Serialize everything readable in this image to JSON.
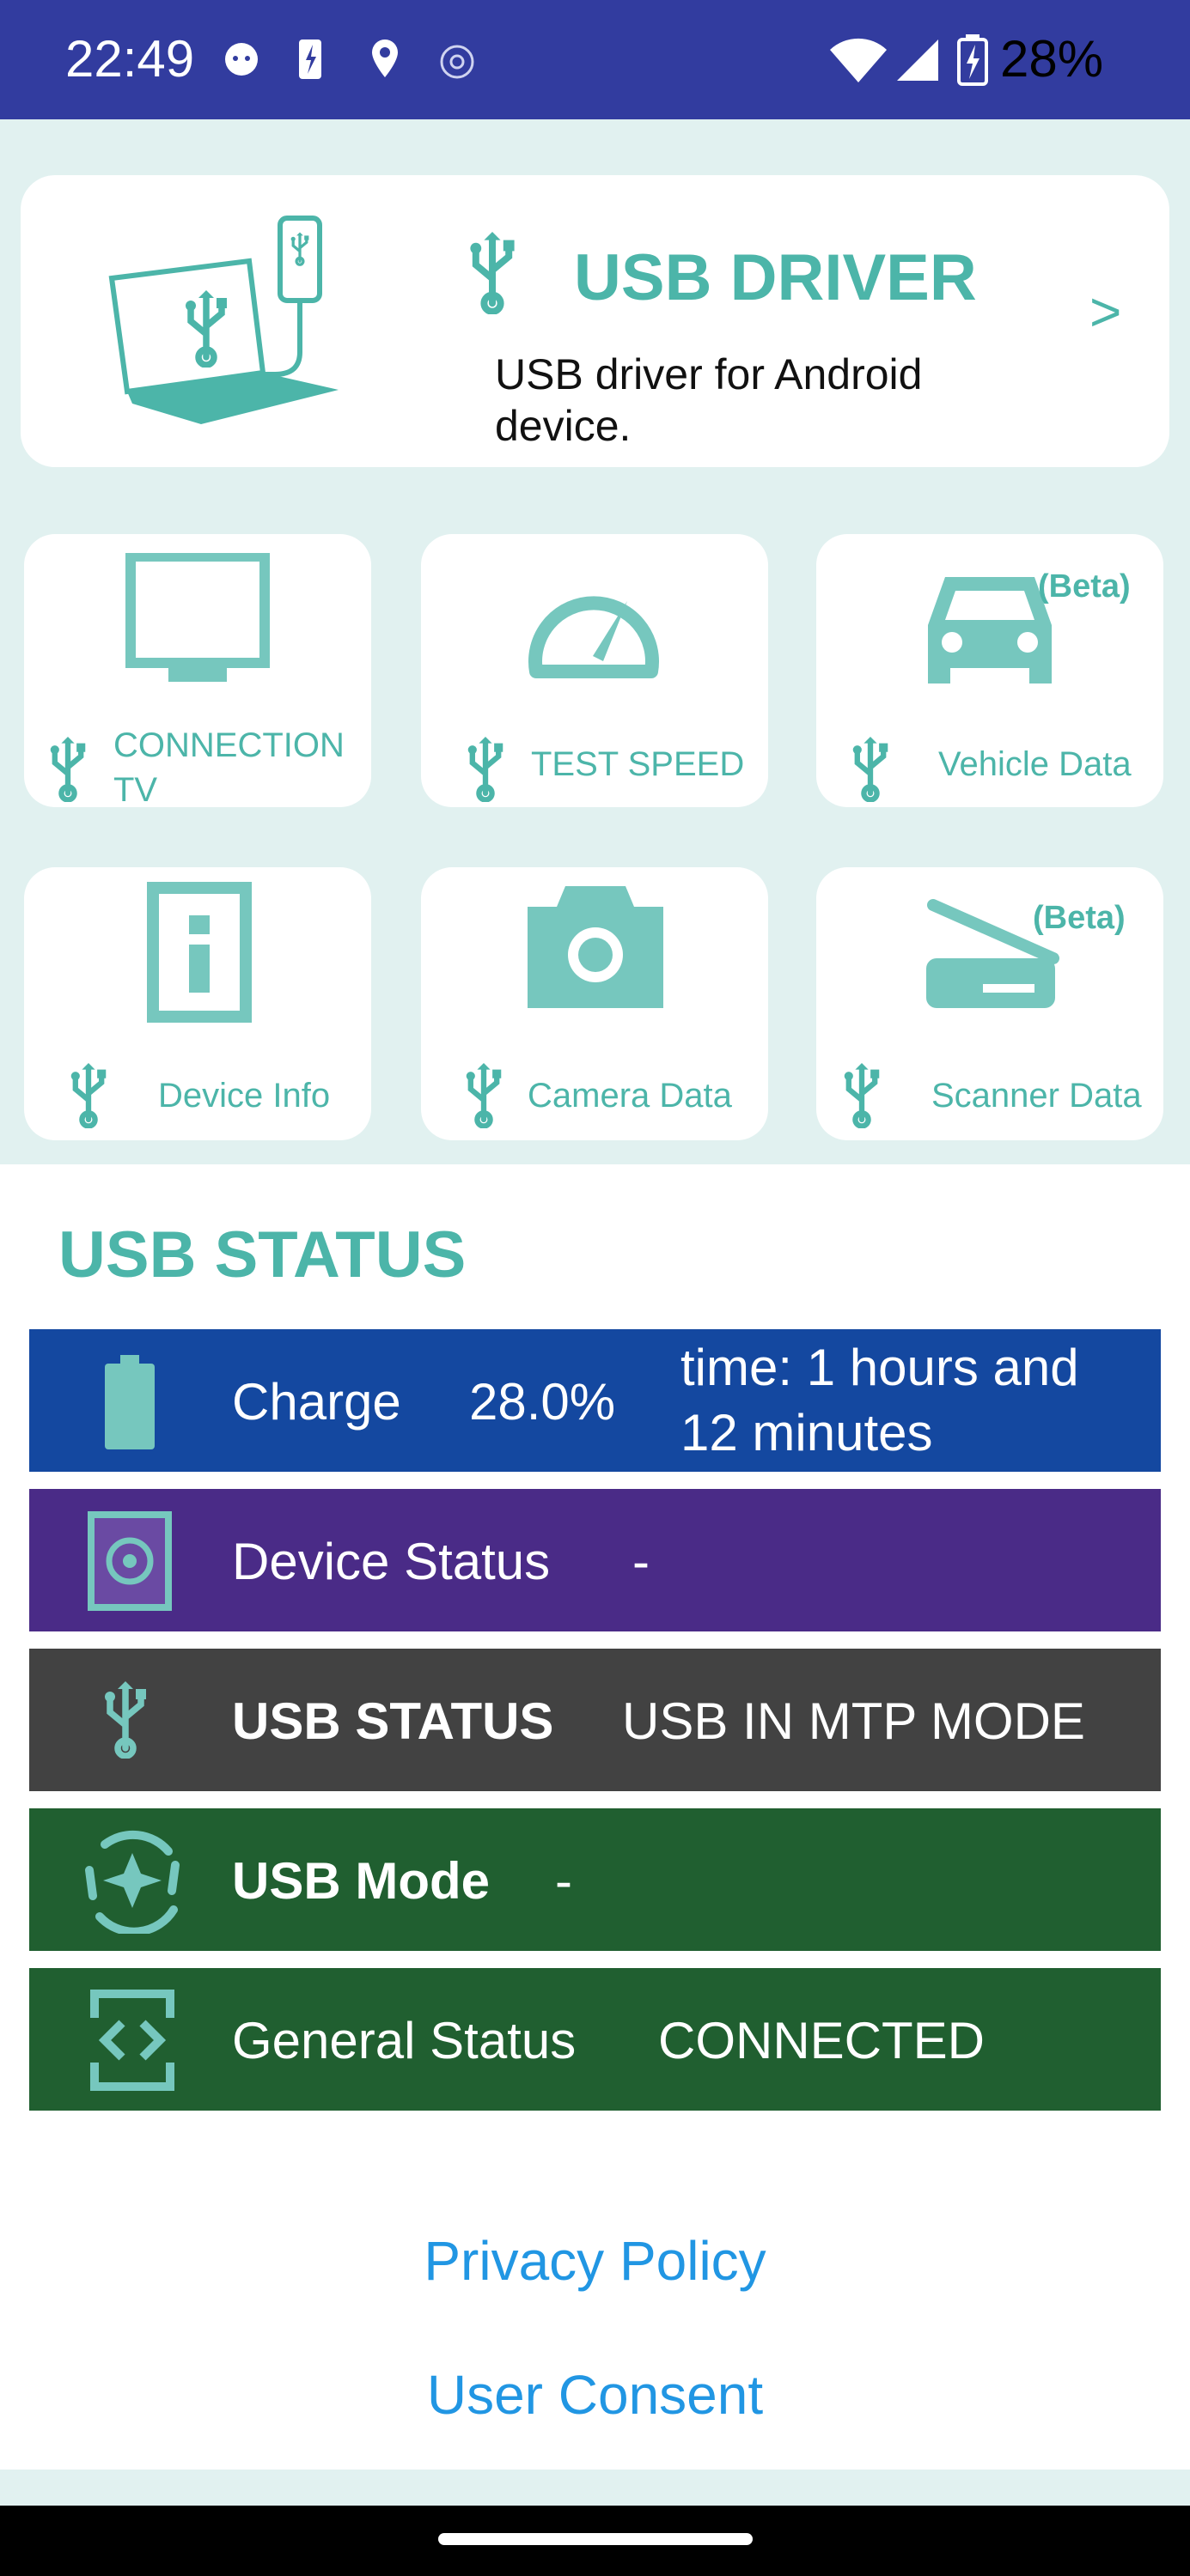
{
  "status_bar": {
    "time": "22:49",
    "battery_percent": "28%"
  },
  "driver_card": {
    "title": "USB DRIVER",
    "description": "USB driver for Android device.",
    "arrow": ">"
  },
  "tiles": [
    {
      "label_line1": "CONNECTION",
      "label_line2": "TV",
      "icon": "tv-icon"
    },
    {
      "label": "TEST SPEED",
      "icon": "speedometer-icon"
    },
    {
      "label": "Vehicle Data",
      "badge": "(Beta)",
      "icon": "car-icon"
    },
    {
      "label": "Device Info",
      "icon": "info-icon"
    },
    {
      "label": "Camera Data",
      "icon": "camera-icon"
    },
    {
      "label": "Scanner Data",
      "badge": "(Beta)",
      "icon": "scanner-icon"
    }
  ],
  "usb_status": {
    "heading": "USB STATUS",
    "rows": [
      {
        "label": "Charge",
        "value": "28.0%",
        "extra_line1": "time: 1 hours and",
        "extra_line2": "12 minutes",
        "color": "#1448a0",
        "icon": "battery-icon"
      },
      {
        "label": "Device Status",
        "value": "-",
        "color": "#4a2b87",
        "icon": "device-status-icon"
      },
      {
        "label": "USB STATUS",
        "value": "USB IN MTP MODE",
        "color": "#424242",
        "icon": "usb-icon"
      },
      {
        "label": "USB Mode",
        "value": "-",
        "color": "#205f30",
        "icon": "usb-mode-icon"
      },
      {
        "label": "General Status",
        "value": "CONNECTED",
        "color": "#205f30",
        "icon": "general-status-icon"
      }
    ]
  },
  "links": {
    "privacy": "Privacy Policy",
    "consent": "User Consent"
  },
  "colors": {
    "accent": "#4cb5a9",
    "link": "#2196e3",
    "status_bar": "#323c9f"
  }
}
